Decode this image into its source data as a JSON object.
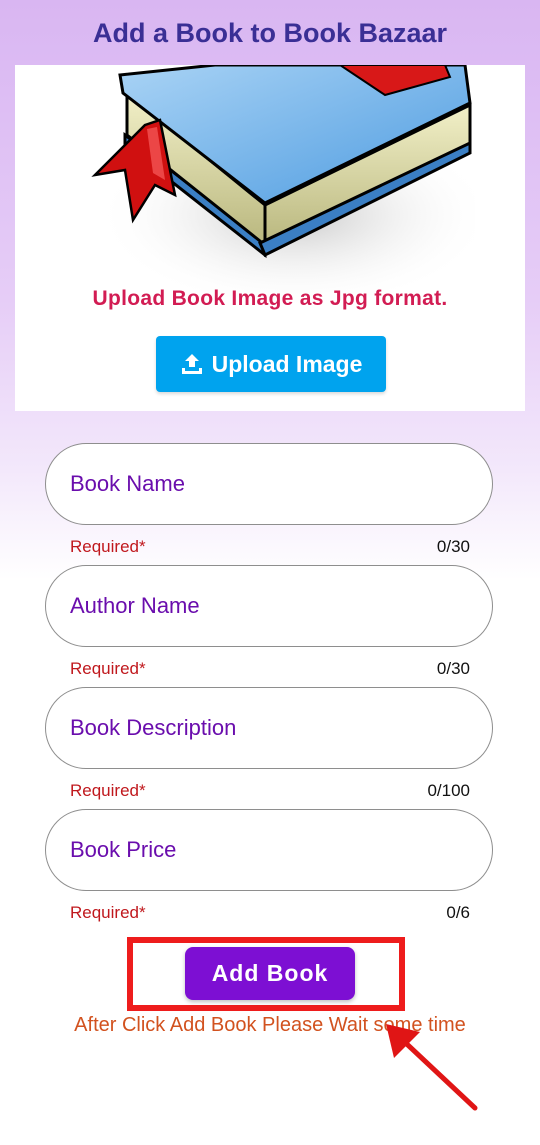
{
  "header": {
    "title": "Add a Book to Book Bazaar"
  },
  "image_section": {
    "hint": "Upload Book Image as Jpg format.",
    "upload_button": "Upload Image"
  },
  "form": {
    "fields": [
      {
        "placeholder": "Book Name",
        "helper": "Required*",
        "counter": "0/30"
      },
      {
        "placeholder": "Author Name",
        "helper": "Required*",
        "counter": "0/30"
      },
      {
        "placeholder": "Book Description",
        "helper": "Required*",
        "counter": "0/100"
      },
      {
        "placeholder": "Book Price",
        "helper": "Required*",
        "counter": "0/6"
      }
    ],
    "submit_label": "Add Book",
    "note": "After Click Add Book Please Wait some time"
  },
  "colors": {
    "title": "#3a2f95",
    "upload_button": "#00a3ee",
    "submit_button": "#7d0fd3",
    "required": "#c0181d",
    "field_text": "#6a0dad",
    "annotation": "#ee1c1c"
  },
  "icons": {
    "upload": "upload-icon",
    "book_illustration": "book-illustration"
  }
}
